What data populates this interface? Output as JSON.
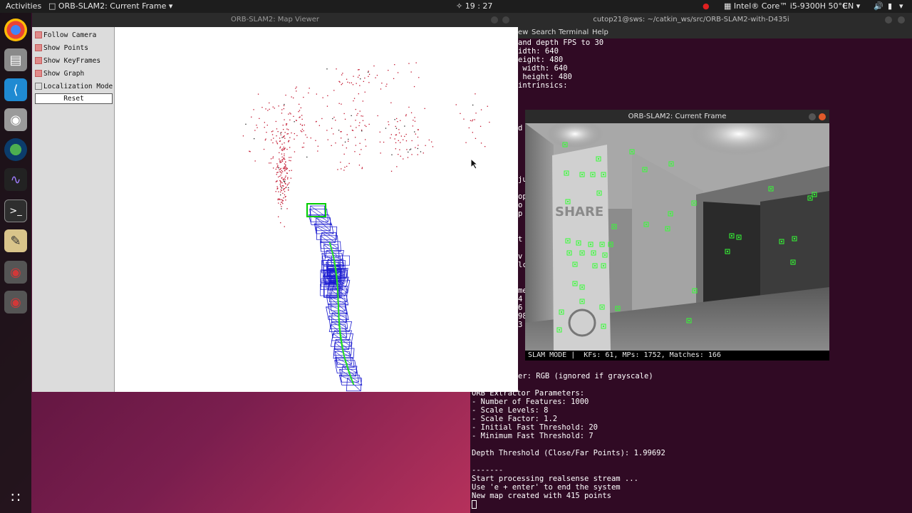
{
  "topbar": {
    "activities": "Activities",
    "app_menu": "ORB-SLAM2: Current Frame",
    "clock": "19 : 27",
    "cpu": "Intel® Core™ i5-9300H 50°C",
    "lang": "EN"
  },
  "dock": {
    "items": [
      "chrome-icon",
      "files-icon",
      "vscode-icon",
      "camera-icon",
      "globe-icon",
      "plot-icon",
      "terminal-icon",
      "text-editor-icon",
      "record-icon",
      "record-icon",
      "apps-grid-icon"
    ]
  },
  "terminal": {
    "title": "cutop21@sws: ~/catkin_ws/src/ORB-SLAM2-with-D435i",
    "menu": [
      "ew",
      "Search",
      "Terminal",
      "Help"
    ],
    "top_lines": [
      "and depth FPS to 30",
      "idth: 640",
      "eight: 480",
      " width: 640",
      " height: 480",
      "intrinsics:"
    ],
    "left_fragments": [
      "d",
      "ju",
      "op",
      "o",
      "p",
      "t",
      "v",
      "lc",
      "me",
      "4",
      "6",
      "98",
      "3"
    ],
    "bottom_lines": [
      "er: RGB (ignored if grayscale)",
      "",
      "ORB Extractor Parameters:",
      "- Number of Features: 1000",
      "- Scale Levels: 8",
      "- Scale Factor: 1.2",
      "- Initial Fast Threshold: 20",
      "- Minimum Fast Threshold: 7",
      "",
      "Depth Threshold (Close/Far Points): 1.99692",
      "",
      "-------",
      "Start processing realsense stream ...",
      "Use 'e + enter' to end the system",
      "New map created with 415 points"
    ]
  },
  "map_viewer": {
    "title": "ORB-SLAM2: Map Viewer",
    "options": [
      {
        "label": "Follow Camera",
        "checked": true
      },
      {
        "label": "Show Points",
        "checked": true
      },
      {
        "label": "Show KeyFrames",
        "checked": true
      },
      {
        "label": "Show Graph",
        "checked": true
      },
      {
        "label": "Localization Mode",
        "checked": false
      }
    ],
    "reset_label": "Reset",
    "colors": {
      "points": "#c0102a",
      "keyframes": "#1a1ad0",
      "graph": "#22e022",
      "current": "#00cc00"
    }
  },
  "current_frame": {
    "title": "ORB-SLAM2: Current Frame",
    "status": "SLAM MODE |  KFs: 61, MPs: 1752, Matches: 166",
    "sign_text": "SHARE",
    "feature_color": "#35ff35"
  }
}
